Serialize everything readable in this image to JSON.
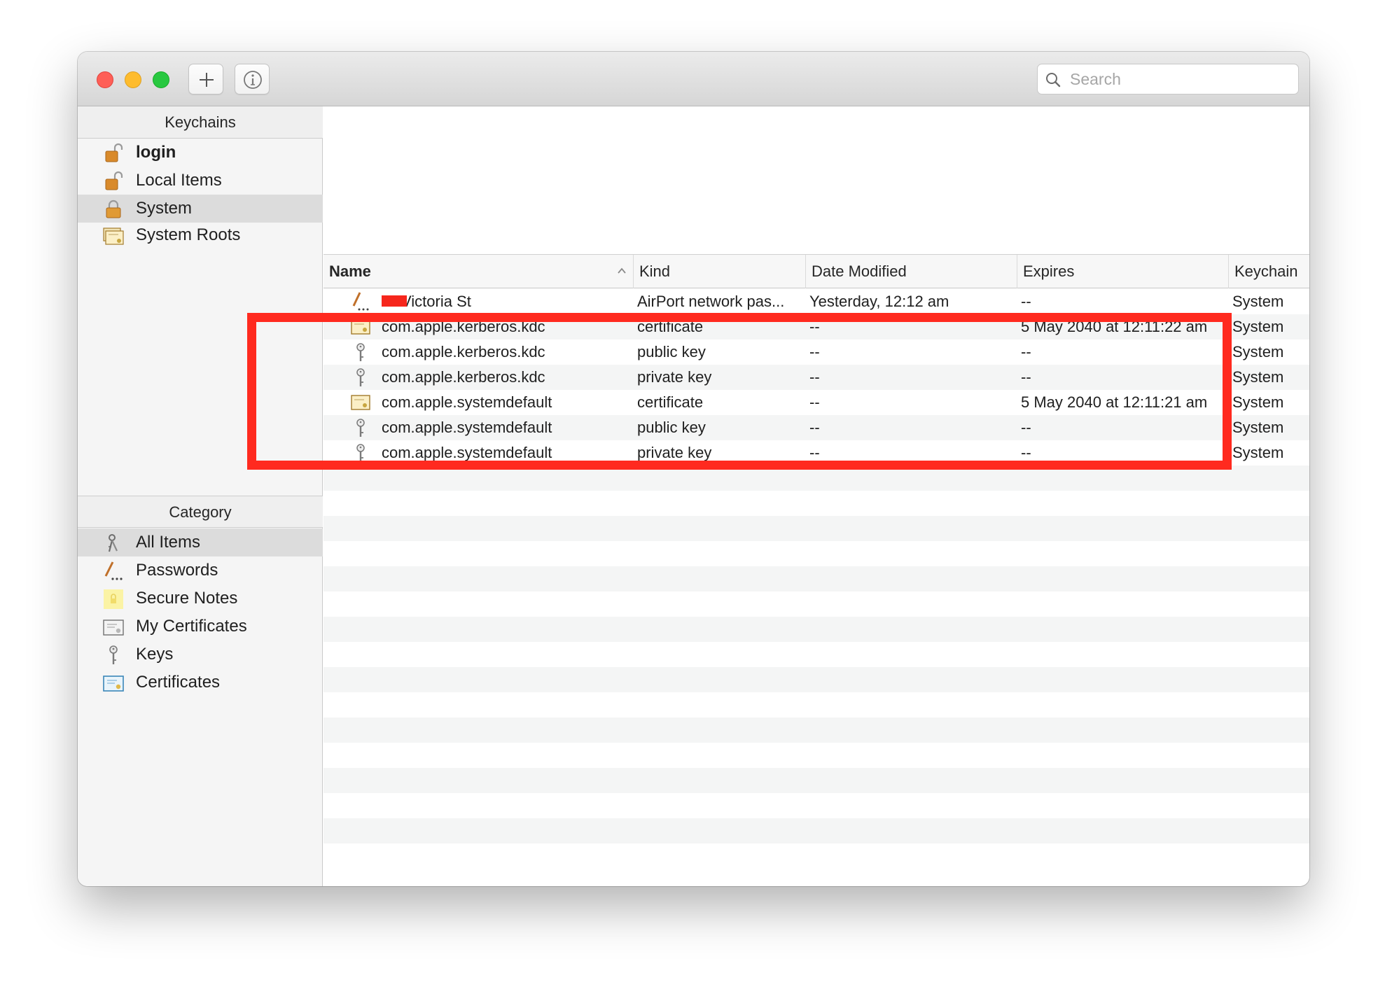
{
  "toolbar": {
    "add_icon": "plus-icon",
    "info_icon": "info-icon"
  },
  "search": {
    "placeholder": "Search"
  },
  "sidebar": {
    "keychains_header": "Keychains",
    "keychains": [
      {
        "label": "login",
        "icon": "unlocked-padlock-icon",
        "bold": true
      },
      {
        "label": "Local Items",
        "icon": "unlocked-padlock-icon"
      },
      {
        "label": "System",
        "icon": "locked-padlock-icon",
        "selected": true
      },
      {
        "label": "System Roots",
        "icon": "certificate-stack-icon"
      }
    ],
    "category_header": "Category",
    "categories": [
      {
        "label": "All Items",
        "icon": "all-items-icon",
        "selected": true
      },
      {
        "label": "Passwords",
        "icon": "password-pencil-icon"
      },
      {
        "label": "Secure Notes",
        "icon": "secure-note-icon"
      },
      {
        "label": "My Certificates",
        "icon": "my-certificate-icon"
      },
      {
        "label": "Keys",
        "icon": "key-icon"
      },
      {
        "label": "Certificates",
        "icon": "certificate-icon"
      }
    ]
  },
  "table": {
    "columns": {
      "name": "Name",
      "kind": "Kind",
      "date_modified": "Date Modified",
      "expires": "Expires",
      "keychain": "Keychain"
    },
    "sort_icon": "chevron-up-icon",
    "rows": [
      {
        "name": "Victoria St",
        "redacted_prefix": true,
        "kind": "AirPort network pas...",
        "date": "Yesterday, 12:12 am",
        "expires": "--",
        "keychain": "System",
        "icon": "password-pencil-icon"
      },
      {
        "name": "com.apple.kerberos.kdc",
        "kind": "certificate",
        "date": "--",
        "expires": "5 May 2040 at 12:11:22 am",
        "keychain": "System",
        "icon": "certificate-icon"
      },
      {
        "name": "com.apple.kerberos.kdc",
        "kind": "public key",
        "date": "--",
        "expires": "--",
        "keychain": "System",
        "icon": "key-icon"
      },
      {
        "name": "com.apple.kerberos.kdc",
        "kind": "private key",
        "date": "--",
        "expires": "--",
        "keychain": "System",
        "icon": "key-icon"
      },
      {
        "name": "com.apple.systemdefault",
        "kind": "certificate",
        "date": "--",
        "expires": "5 May 2040 at 12:11:21 am",
        "keychain": "System",
        "icon": "certificate-icon"
      },
      {
        "name": "com.apple.systemdefault",
        "kind": "public key",
        "date": "--",
        "expires": "--",
        "keychain": "System",
        "icon": "key-icon"
      },
      {
        "name": "com.apple.systemdefault",
        "kind": "private key",
        "date": "--",
        "expires": "--",
        "keychain": "System",
        "icon": "key-icon"
      }
    ],
    "empty_rows": 16
  },
  "colors": {
    "highlight": "#ff2a1f",
    "row_stripe": "#f4f5f5",
    "selected_sidebar": "#dcdcdc"
  }
}
